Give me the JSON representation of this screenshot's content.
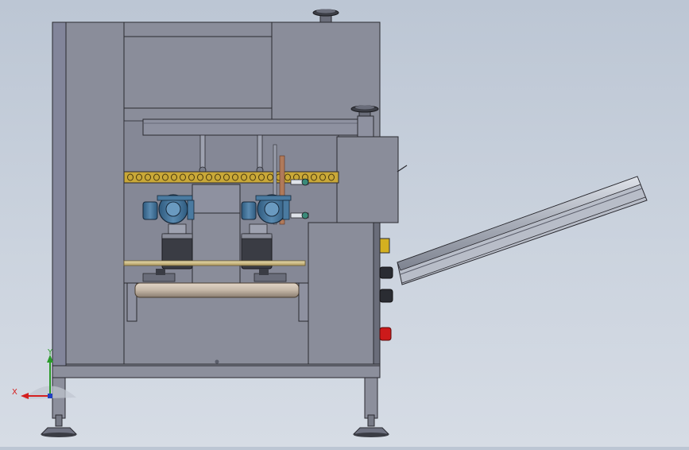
{
  "viewport": {
    "background_top": "#bcc6d4",
    "background_bottom": "#d6dce5"
  },
  "triad": {
    "x_label": "X",
    "y_label": "Y",
    "x_color": "#d42020",
    "y_color": "#2a9a2a",
    "z_color": "#2040c0"
  },
  "colors": {
    "frame": "#8c8f9c",
    "frame_dark": "#767987",
    "panel": "#8a8d9a",
    "motor_blue": "#3a6a90",
    "chain_gold": "#c9a838",
    "roller": "#c4b6a6",
    "estop_red": "#cc1a1a",
    "indicator_yellow": "#d4b020"
  }
}
